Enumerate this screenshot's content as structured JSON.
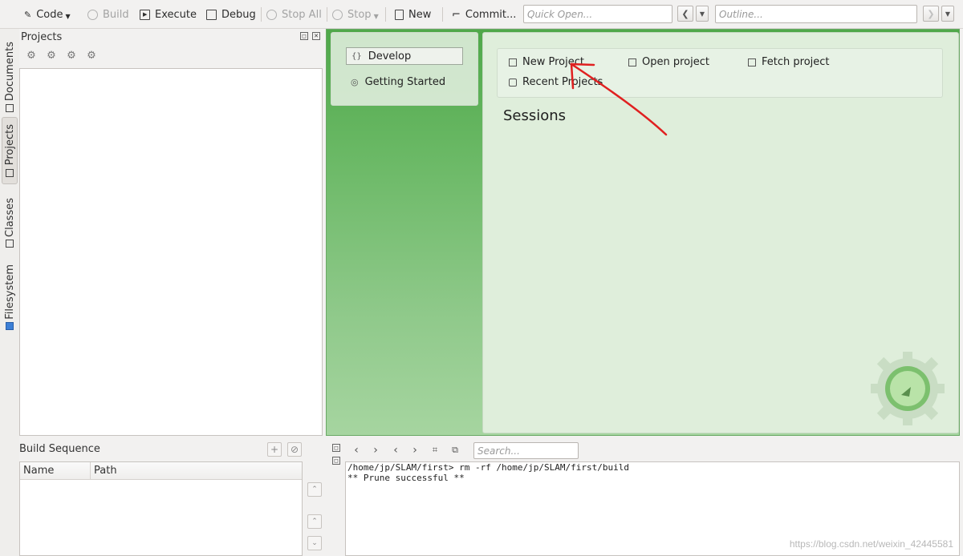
{
  "toolbar": {
    "code": "Code",
    "build": "Build",
    "execute": "Execute",
    "debug": "Debug",
    "stop_all": "Stop All",
    "stop": "Stop",
    "new": "New",
    "commit": "Commit...",
    "quick_open_placeholder": "Quick Open...",
    "outline_placeholder": "Outline..."
  },
  "vtabs": {
    "documents": "Documents",
    "projects": "Projects",
    "classes": "Classes",
    "filesystem": "Filesystem"
  },
  "projects_panel": {
    "title": "Projects"
  },
  "welcome": {
    "nav": {
      "develop": "Develop",
      "getting_started": "Getting Started"
    },
    "actions": {
      "new_project": "New Project",
      "open_project": "Open project",
      "fetch_project": "Fetch project",
      "recent_projects": "Recent Projects"
    },
    "sessions_title": "Sessions"
  },
  "build_sequence": {
    "title": "Build Sequence",
    "columns": [
      "Name",
      "Path"
    ]
  },
  "output": {
    "search_placeholder": "Search...",
    "lines": [
      "/home/jp/SLAM/first> rm -rf /home/jp/SLAM/first/build",
      "** Prune successful **"
    ]
  },
  "watermark": "https://blog.csdn.net/weixin_42445581",
  "colors": {
    "welcome_green": "#4fa84a",
    "annotation_red": "#e02020"
  },
  "icons": [
    "code-icon",
    "build-icon",
    "execute-icon",
    "debug-icon",
    "stop-all-icon",
    "stop-icon",
    "new-icon",
    "commit-icon"
  ]
}
